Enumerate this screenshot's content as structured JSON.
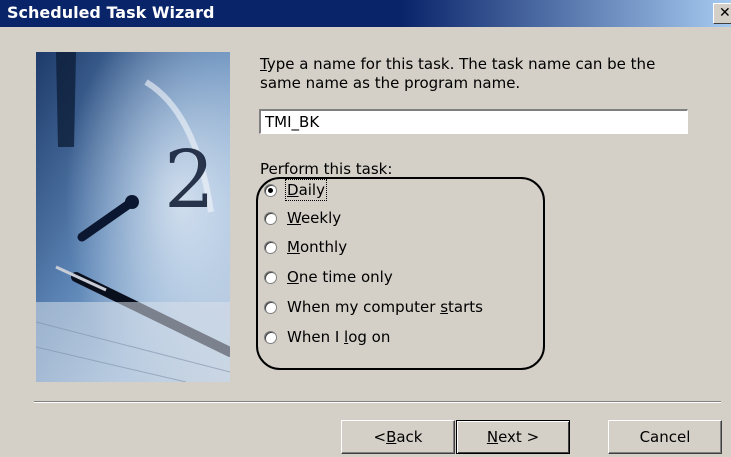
{
  "window": {
    "title": "Scheduled Task Wizard",
    "close_glyph": "✕"
  },
  "prompt": {
    "first_letter": "T",
    "rest": "ype a name for this task.  The task name can be the same name as the program name."
  },
  "task_name": {
    "value": "TMI_BK"
  },
  "perform": {
    "label": "Perform this task:",
    "options": [
      {
        "pre": "",
        "accel": "D",
        "post": "aily",
        "selected": true
      },
      {
        "pre": "",
        "accel": "W",
        "post": "eekly",
        "selected": false
      },
      {
        "pre": "",
        "accel": "M",
        "post": "onthly",
        "selected": false
      },
      {
        "pre": "",
        "accel": "O",
        "post": "ne time only",
        "selected": false
      },
      {
        "pre": "When my computer ",
        "accel": "s",
        "post": "tarts",
        "selected": false
      },
      {
        "pre": "When I ",
        "accel": "l",
        "post": "og on",
        "selected": false
      }
    ]
  },
  "buttons": {
    "back": {
      "pre": "< ",
      "accel": "B",
      "post": "ack"
    },
    "next": {
      "pre": "",
      "accel": "N",
      "post": "ext >"
    },
    "cancel": {
      "label": "Cancel"
    }
  },
  "colors": {
    "title_bar": "#0a246a",
    "face": "#d4d0c8"
  }
}
